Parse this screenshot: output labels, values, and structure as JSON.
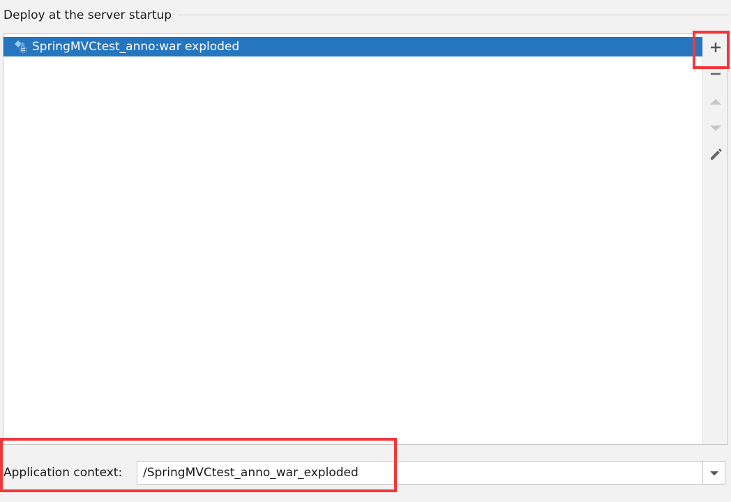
{
  "section": {
    "title": "Deploy at the server startup"
  },
  "artifacts": [
    {
      "label": "SpringMVCtest_anno:war exploded",
      "icon": "web-artifact-icon",
      "selected": true
    }
  ],
  "toolbar": {
    "add": "add-icon",
    "remove": "remove-icon",
    "move_up": "move-up-icon",
    "move_down": "move-down-icon",
    "edit": "edit-icon"
  },
  "context": {
    "label": "Application context:",
    "value": "/SpringMVCtest_anno_war_exploded",
    "dropdown": "chevron-down-icon"
  },
  "colors": {
    "selection": "#2675bf",
    "highlight": "#f0383b",
    "background": "#f2f2f2"
  }
}
